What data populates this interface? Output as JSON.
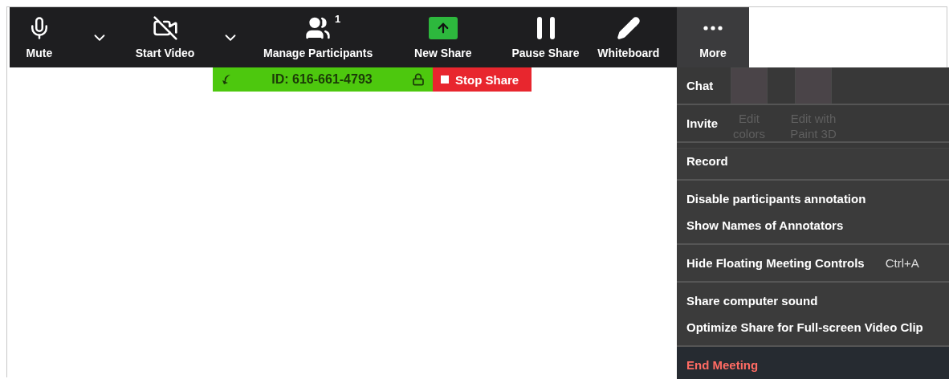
{
  "toolbar": [
    {
      "kind": "mute",
      "label": "Mute",
      "selected": false
    },
    {
      "kind": "caret",
      "selected": false
    },
    {
      "kind": "video",
      "label": "Start Video",
      "selected": false
    },
    {
      "kind": "caret",
      "selected": false
    },
    {
      "kind": "participants",
      "label": "Manage Participants",
      "badge": "1",
      "selected": false
    },
    {
      "kind": "share",
      "label": "New Share",
      "selected": false
    },
    {
      "kind": "pause",
      "label": "Pause Share",
      "selected": false
    },
    {
      "kind": "whiteboard",
      "label": "Whiteboard",
      "selected": false
    },
    {
      "kind": "more",
      "label": "More",
      "selected": true
    }
  ],
  "share_bar": {
    "meeting_id": "ID: 616-661-4793",
    "stop_label": "Stop Share"
  },
  "background_ribbon": [
    "Edit colors",
    "Edit with Paint 3D"
  ],
  "menu": [
    [
      {
        "label": "Chat",
        "kind": "item"
      }
    ],
    [
      {
        "label": "Invite",
        "kind": "item"
      }
    ],
    [
      {
        "label": "Record",
        "kind": "item"
      }
    ],
    [
      {
        "label": "Disable participants annotation",
        "kind": "item"
      },
      {
        "label": "Show Names of Annotators",
        "kind": "item"
      }
    ],
    [
      {
        "label": "Hide Floating Meeting Controls",
        "shortcut": "Ctrl+A",
        "kind": "item"
      }
    ],
    [
      {
        "label": "Share computer sound",
        "kind": "item"
      },
      {
        "label": "Optimize Share for Full-screen Video Clip",
        "kind": "item"
      }
    ],
    [
      {
        "label": "End Meeting",
        "kind": "danger"
      }
    ]
  ]
}
